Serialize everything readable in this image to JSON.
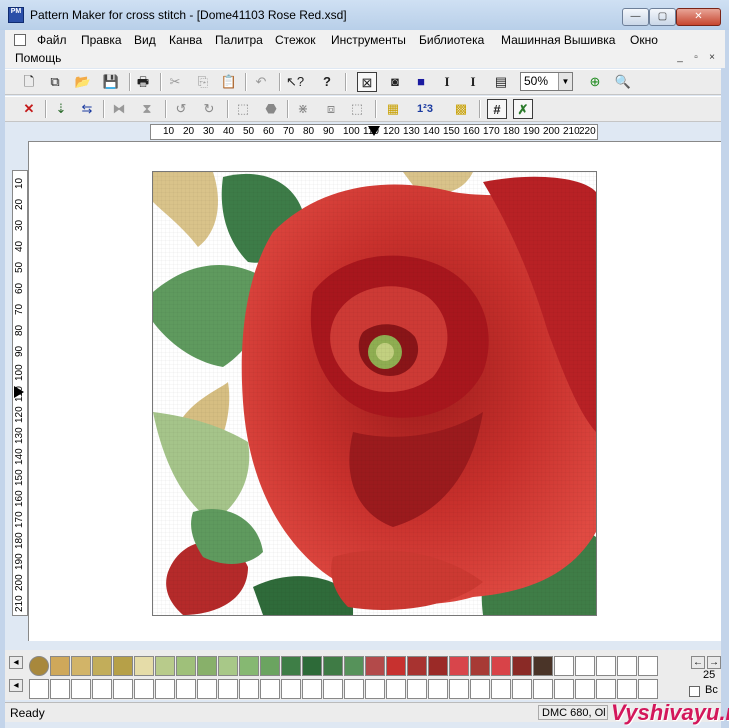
{
  "window": {
    "title": "Pattern Maker for cross stitch - [Dome41103 Rose Red.xsd]",
    "app_icon_label": "PM",
    "min_label": "—",
    "max_label": "▢",
    "close_label": "✕"
  },
  "menu": {
    "items": [
      "Файл",
      "Правка",
      "Вид",
      "Канва",
      "Палитра",
      "Стежок",
      "Инструменты",
      "Библиотека",
      "Машинная Вышивка",
      "Окно",
      "Помощь"
    ]
  },
  "toolbar": {
    "zoom_value": "50%",
    "text_tool": "I",
    "sub_text": "I",
    "superscript": "1²3"
  },
  "ruler": {
    "h_labels": [
      "10",
      "20",
      "30",
      "40",
      "50",
      "60",
      "70",
      "80",
      "90",
      "100",
      "110",
      "120",
      "130",
      "140",
      "150",
      "160",
      "170",
      "180",
      "190",
      "200",
      "210",
      "220"
    ],
    "v_labels": [
      "10",
      "20",
      "30",
      "40",
      "50",
      "60",
      "70",
      "80",
      "90",
      "100",
      "110",
      "120",
      "130",
      "140",
      "150",
      "160",
      "170",
      "180",
      "190",
      "200",
      "210"
    ]
  },
  "palette": {
    "colors": [
      "#a8883c",
      "#cfa85a",
      "#d2b468",
      "#c2ad5a",
      "#b6a048",
      "#e5dca8",
      "#b8cb8b",
      "#9fc07a",
      "#88b06a",
      "#a8c888",
      "#86b872",
      "#6ba460",
      "#3e7e46",
      "#2d6a38",
      "#3f7b45",
      "#56925a",
      "#b34a4a",
      "#c7312f",
      "#a83330",
      "#9b2a27",
      "#d8454b",
      "#a73a35",
      "#d84348",
      "#8a2a26",
      "#4a3428"
    ],
    "count": "25",
    "bc_label": "Вс"
  },
  "status": {
    "ready": "Ready",
    "dmc": "DMC  680, Ol"
  },
  "watermark": "Vyshivayu.ru"
}
